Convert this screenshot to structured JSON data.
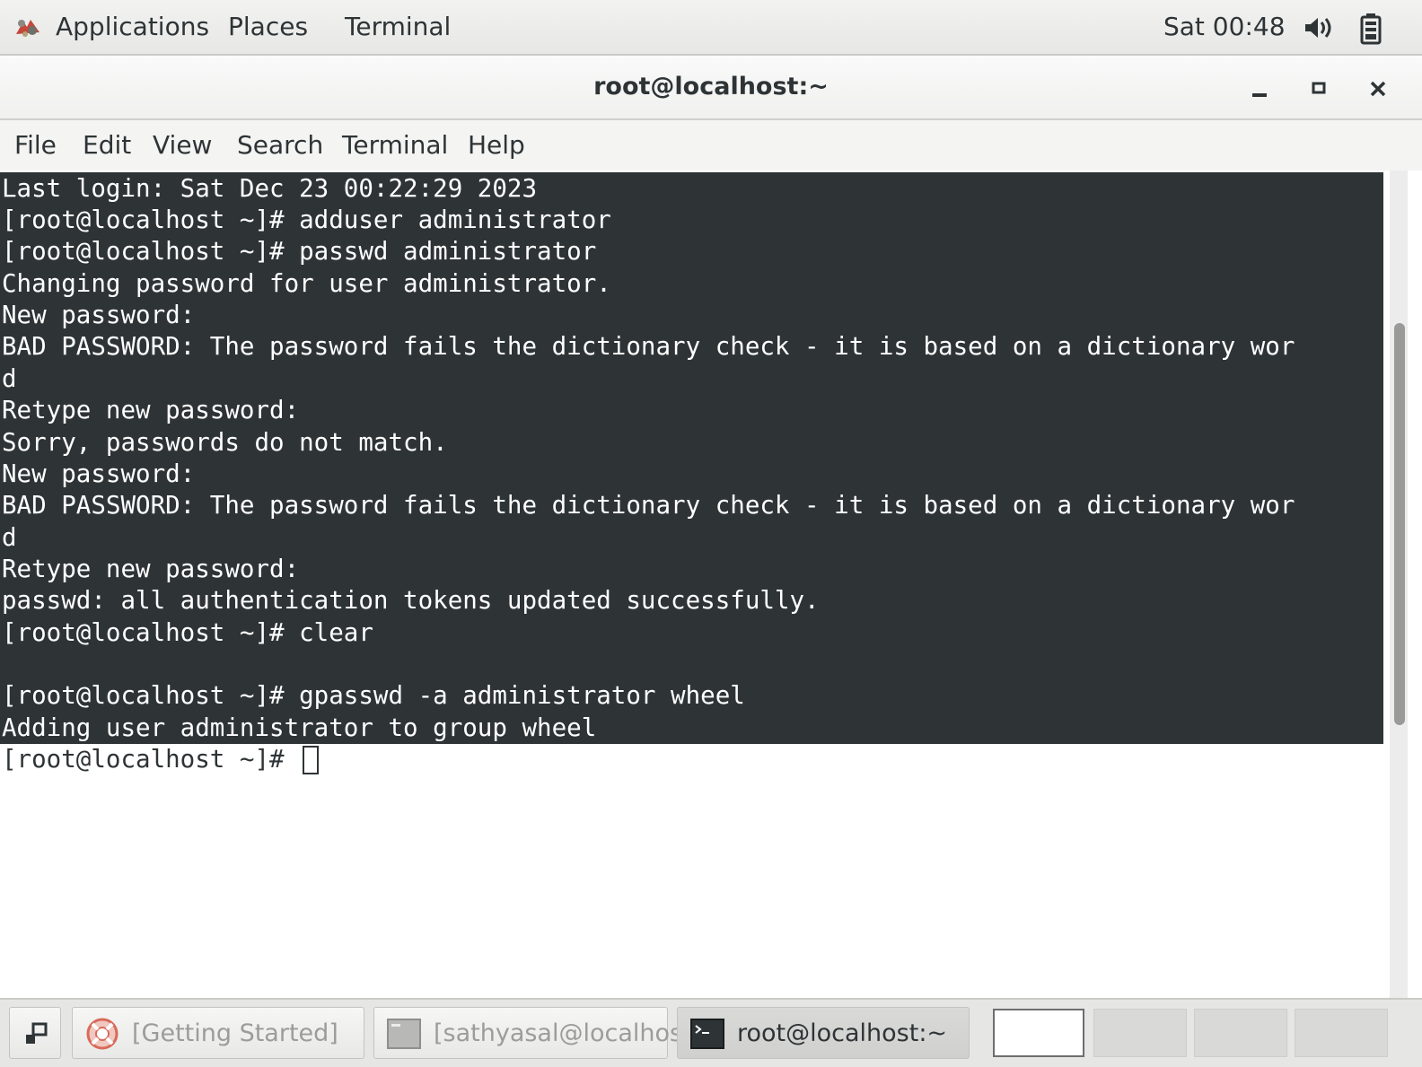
{
  "top_panel": {
    "applications_label": "Applications",
    "places_label": "Places",
    "terminal_label": "Terminal",
    "clock": "Sat 00:48"
  },
  "window": {
    "title": "root@localhost:~"
  },
  "menubar": {
    "items": [
      "File",
      "Edit",
      "View",
      "Search",
      "Terminal",
      "Help"
    ]
  },
  "terminal": {
    "lines": [
      "Last login: Sat Dec 23 00:22:29 2023",
      "[root@localhost ~]# adduser administrator",
      "[root@localhost ~]# passwd administrator",
      "Changing password for user administrator.",
      "New password:",
      "BAD PASSWORD: The password fails the dictionary check - it is based on a dictionary wor",
      "d",
      "Retype new password:",
      "Sorry, passwords do not match.",
      "New password:",
      "BAD PASSWORD: The password fails the dictionary check - it is based on a dictionary wor",
      "d",
      "Retype new password:",
      "passwd: all authentication tokens updated successfully.",
      "[root@localhost ~]# clear",
      "",
      "[root@localhost ~]# gpasswd -a administrator wheel",
      "Adding user administrator to group wheel"
    ],
    "prompt": "[root@localhost ~]# "
  },
  "taskbar": {
    "tasks": [
      {
        "label": "[Getting Started]",
        "active": false
      },
      {
        "label": "[sathyasal@localhos...",
        "active": false
      },
      {
        "label": "root@localhost:~",
        "active": true
      }
    ],
    "workspace_count": 4,
    "current_workspace": 1
  },
  "colors": {
    "terminal_bg": "#2e3436",
    "terminal_fg": "#ffffff",
    "panel_text": "#2e3436"
  }
}
